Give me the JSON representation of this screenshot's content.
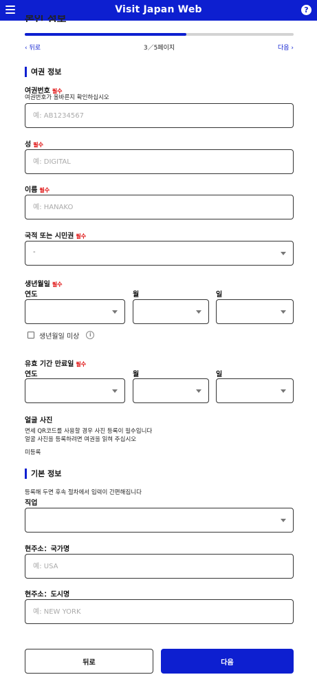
{
  "app": {
    "title": "Visit Japan Web",
    "help_symbol": "?",
    "page_heading": "본인 정보"
  },
  "progress": {
    "current": 3,
    "total": 5,
    "fraction": 0.6
  },
  "pager": {
    "prev_label": "‹ 뒤로",
    "page_label": "3／5페이지",
    "next_label": "다음 ›"
  },
  "required_text": "필수",
  "passport_section": {
    "title": "여권 정보",
    "passport_number": {
      "label": "여권번호",
      "help": "여권번호가 올바른지 확인하십시오",
      "placeholder": "예: AB1234567"
    },
    "surname": {
      "label": "성",
      "placeholder": "예: DIGITAL"
    },
    "given_name": {
      "label": "이름",
      "placeholder": "예: HANAKO"
    },
    "nationality": {
      "label": "국적 또는 시민권",
      "value": "-"
    },
    "birth_date": {
      "label": "생년월일",
      "year_label": "연도",
      "month_label": "월",
      "day_label": "일",
      "unknown_label": "생년월일 미상"
    },
    "expiry_date": {
      "label": "유효 기간 만료일",
      "year_label": "연도",
      "month_label": "월",
      "day_label": "일"
    },
    "photo": {
      "label": "얼굴 사진",
      "help_line1": "면세 QR코드를 사용할 경우 사진 등록이 필수입니다",
      "help_line2": "얼굴 사진을 등록하려면 여권을 읽혀 주십시오",
      "status": "미등록"
    }
  },
  "basic_section": {
    "title": "기본 정보",
    "help": "등록해 두면 후속 절차에서 입력이 간편해집니다",
    "occupation": {
      "label": "직업"
    },
    "country": {
      "label": "현주소：국가명",
      "placeholder": "예: USA"
    },
    "city": {
      "label": "현주소：도시명",
      "placeholder": "예: NEW YORK"
    }
  },
  "buttons": {
    "back": "뒤로",
    "next": "다음"
  },
  "colors": {
    "brand": "#0d1fd0",
    "required": "#dd0000"
  }
}
